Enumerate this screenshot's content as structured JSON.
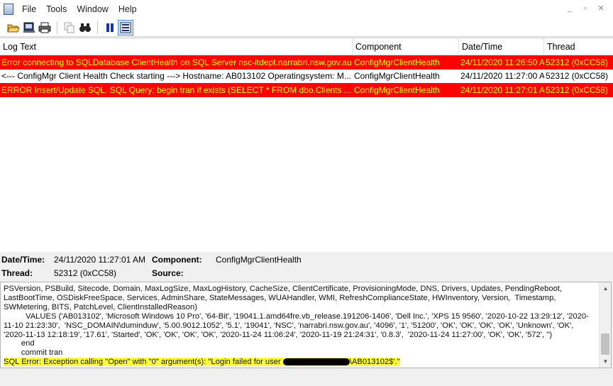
{
  "menu": {
    "file": "File",
    "tools": "Tools",
    "window": "Window",
    "help": "Help"
  },
  "window_controls": {
    "minimize": "_",
    "restore": "▫",
    "close": "✕"
  },
  "toolbar": {
    "buttons": [
      "open-icon",
      "print-preview-icon",
      "print-icon",
      "copy-icon",
      "find-icon",
      "pause-icon",
      "highlight-icon"
    ]
  },
  "columns": {
    "log_text": "Log Text",
    "component": "Component",
    "datetime": "Date/Time",
    "thread": "Thread"
  },
  "rows": [
    {
      "type": "error",
      "log_text": "Error connecting to SQLDatabase ClientHealth on SQL Server nsc-itdept.narrabri.nsw.gov.au",
      "component": "ConfigMgrClientHealth",
      "datetime": "24/11/2020 11:26:50 A",
      "thread": "52312 (0xCC58)"
    },
    {
      "type": "info",
      "log_text": "<--- ConfigMgr Client Health Check starting ---> Hostname: AB013102 Operatingsystem: M...",
      "component": "ConfigMgrClientHealth",
      "datetime": "24/11/2020 11:27:00 A",
      "thread": "52312 (0xCC58)"
    },
    {
      "type": "error",
      "log_text": "ERROR Insert/Update SQL. SQL Query: begin tran          if exists (SELECT * FROM dbo.Clients ...",
      "component": "ConfigMgrClientHealth",
      "datetime": "24/11/2020 11:27:01 A",
      "thread": "52312 (0xCC58)"
    }
  ],
  "details": {
    "datetime_label": "Date/Time:",
    "datetime_value": "24/11/2020 11:27:01 AM",
    "component_label": "Component:",
    "component_value": "ConfigMgrClientHealth",
    "thread_label": "Thread:",
    "thread_value": "52312 (0xCC58)",
    "source_label": "Source:"
  },
  "message": {
    "body": "PSVersion, PSBuild, Sitecode, Domain, MaxLogSize, MaxLogHistory, CacheSize, ClientCertificate, ProvisioningMode, DNS, Drivers, Updates, PendingReboot, LastBootTime, OSDiskFreeSpace, Services, AdminShare, StateMessages, WUAHandler, WMI, RefreshComplianceState, HWInventory, Version,  Timestamp, SWMetering, BITS, PatchLevel, ClientInstalledReason)\n          VALUES ('AB013102', 'Microsoft Windows 10 Pro', '64-Bit', '19041.1.amd64fre.vb_release.191206-1406', 'Dell Inc.', 'XPS 15 9560', '2020-10-22 13:29:12', '2020-11-10 21:23:30',  'NSC_DOMAIN\\duminduw', '5.00.9012.1052', '5.1', '19041', 'NSC', 'narrabri.nsw.gov.au', '4096', '1', '51200', 'OK', 'OK', 'OK', 'OK', 'Unknown', 'OK', '2020-11-13 12:18:19', '17.61', 'Started', 'OK', 'OK', 'OK', 'OK', '2020-11-24 11:06:24', '2020-11-19 21:24:31', '0.8.3',  '2020-11-24 11:27:00', 'OK', 'OK', '572', '')\n        end\n        commit tran",
    "error_prefix": "SQL Error: Exception calling \"Open\" with \"0\" argument(s): \"Login failed for user ",
    "error_suffix": "\\AB013102$'.\""
  }
}
